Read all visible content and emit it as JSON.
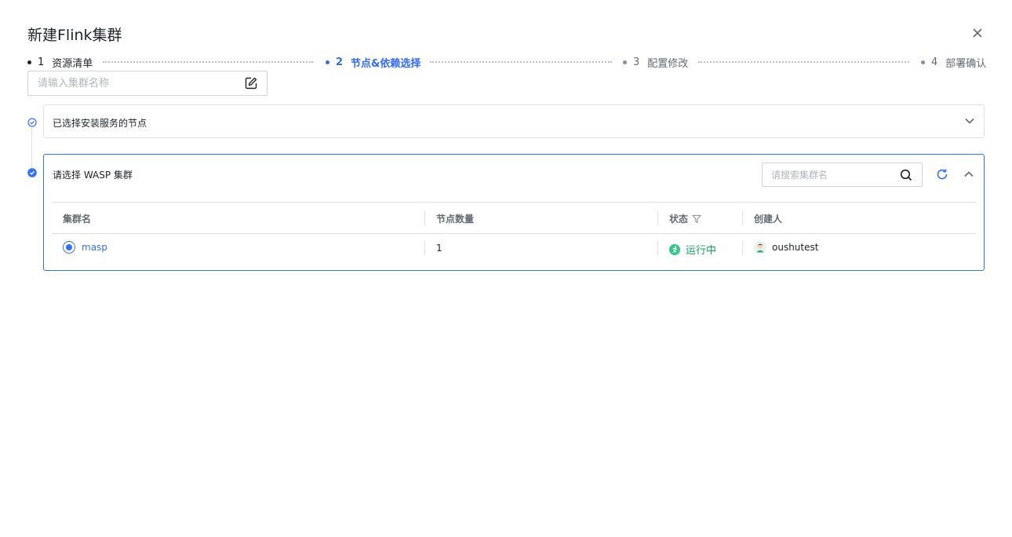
{
  "dialog": {
    "title": "新建Flink集群"
  },
  "steps": [
    {
      "num": "1",
      "label": "资源清单"
    },
    {
      "num": "2",
      "label": "节点&依赖选择"
    },
    {
      "num": "3",
      "label": "配置修改"
    },
    {
      "num": "4",
      "label": "部署确认"
    }
  ],
  "cluster_name": {
    "placeholder": "请输入集群名称",
    "value": ""
  },
  "section_nodes": {
    "label": "已选择安装服务的节点"
  },
  "section_wasp": {
    "label": "请选择 WASP 集群",
    "search_placeholder": "请搜索集群名",
    "columns": [
      "集群名",
      "节点数量",
      "状态",
      "创建人"
    ],
    "rows": [
      {
        "name": "masp",
        "node_count": "1",
        "status": "运行中",
        "creator": "oushutest",
        "selected": true
      }
    ]
  },
  "colors": {
    "primary": "#3370ff",
    "status_running": "#14a35e",
    "border": "#dee0e3"
  }
}
